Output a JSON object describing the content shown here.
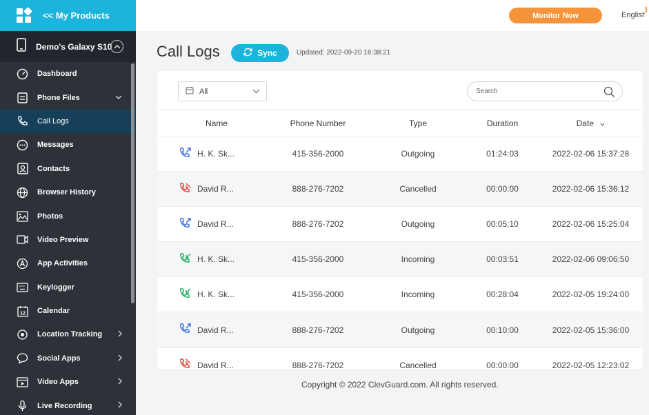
{
  "app": {
    "products_link": "<< My Products",
    "device_name": "Demo's Galaxy S10",
    "monitor_button": "Monitor Now",
    "language": "English"
  },
  "sidebar": {
    "items": [
      {
        "label": "Dashboard",
        "icon": "dashboard-icon"
      },
      {
        "label": "Phone Files",
        "icon": "phone-files-icon"
      },
      {
        "label": "Call Logs",
        "icon": "phone-icon"
      },
      {
        "label": "Messages",
        "icon": "message-icon"
      },
      {
        "label": "Contacts",
        "icon": "contacts-icon"
      },
      {
        "label": "Browser History",
        "icon": "globe-icon"
      },
      {
        "label": "Photos",
        "icon": "photo-icon"
      },
      {
        "label": "Video Preview",
        "icon": "video-icon"
      },
      {
        "label": "App Activities",
        "icon": "app-icon"
      },
      {
        "label": "Keylogger",
        "icon": "keyboard-icon"
      },
      {
        "label": "Calendar",
        "icon": "calendar-icon"
      },
      {
        "label": "Location Tracking",
        "icon": "location-icon"
      },
      {
        "label": "Social Apps",
        "icon": "chat-bubble-icon"
      },
      {
        "label": "Video Apps",
        "icon": "film-icon"
      },
      {
        "label": "Live Recording",
        "icon": "microphone-icon"
      }
    ]
  },
  "page": {
    "title": "Call Logs",
    "sync_label": "Sync",
    "updated": "Updated: 2022-09-20 16:38:21",
    "filter_value": "All",
    "search_placeholder": "Search",
    "copyright": "Copyright © 2022 ClevGuard.com. All rights reserved."
  },
  "table": {
    "headers": {
      "name": "Name",
      "phone": "Phone Number",
      "type": "Type",
      "duration": "Duration",
      "date": "Date"
    },
    "rows": [
      {
        "name": "H. K. Sk...",
        "phone": "415-356-2000",
        "type": "Outgoing",
        "duration": "01:24:03",
        "date": "2022-02-06 15:37:28",
        "icon": "outgoing-call-icon"
      },
      {
        "name": "David R...",
        "phone": "888-276-7202",
        "type": "Cancelled",
        "duration": "00:00:00",
        "date": "2022-02-06 15:36:12",
        "icon": "cancelled-call-icon"
      },
      {
        "name": "David R...",
        "phone": "888-276-7202",
        "type": "Outgoing",
        "duration": "00:05:10",
        "date": "2022-02-06 15:25:04",
        "icon": "outgoing-call-icon"
      },
      {
        "name": "H. K. Sk...",
        "phone": "415-356-2000",
        "type": "Incoming",
        "duration": "00:03:51",
        "date": "2022-02-06 09:06:50",
        "icon": "incoming-call-icon"
      },
      {
        "name": "H. K. Sk...",
        "phone": "415-356-2000",
        "type": "Incoming",
        "duration": "00:28:04",
        "date": "2022-02-05 19:24:00",
        "icon": "incoming-call-icon"
      },
      {
        "name": "David R...",
        "phone": "888-276-7202",
        "type": "Outgoing",
        "duration": "00:10:00",
        "date": "2022-02-05 15:36:00",
        "icon": "outgoing-call-icon"
      },
      {
        "name": "David R...",
        "phone": "888-276-7202",
        "type": "Cancelled",
        "duration": "00:00:00",
        "date": "2022-02-05 12:23:02",
        "icon": "cancelled-call-icon"
      }
    ]
  },
  "colors": {
    "accent": "#1cb4dc",
    "sidebar_bg": "#2c3238",
    "active_item": "#16405a",
    "monitor_button": "#f5943b",
    "outgoing": "#3a6fd8",
    "incoming": "#1fae5f",
    "cancelled": "#e0463c"
  }
}
